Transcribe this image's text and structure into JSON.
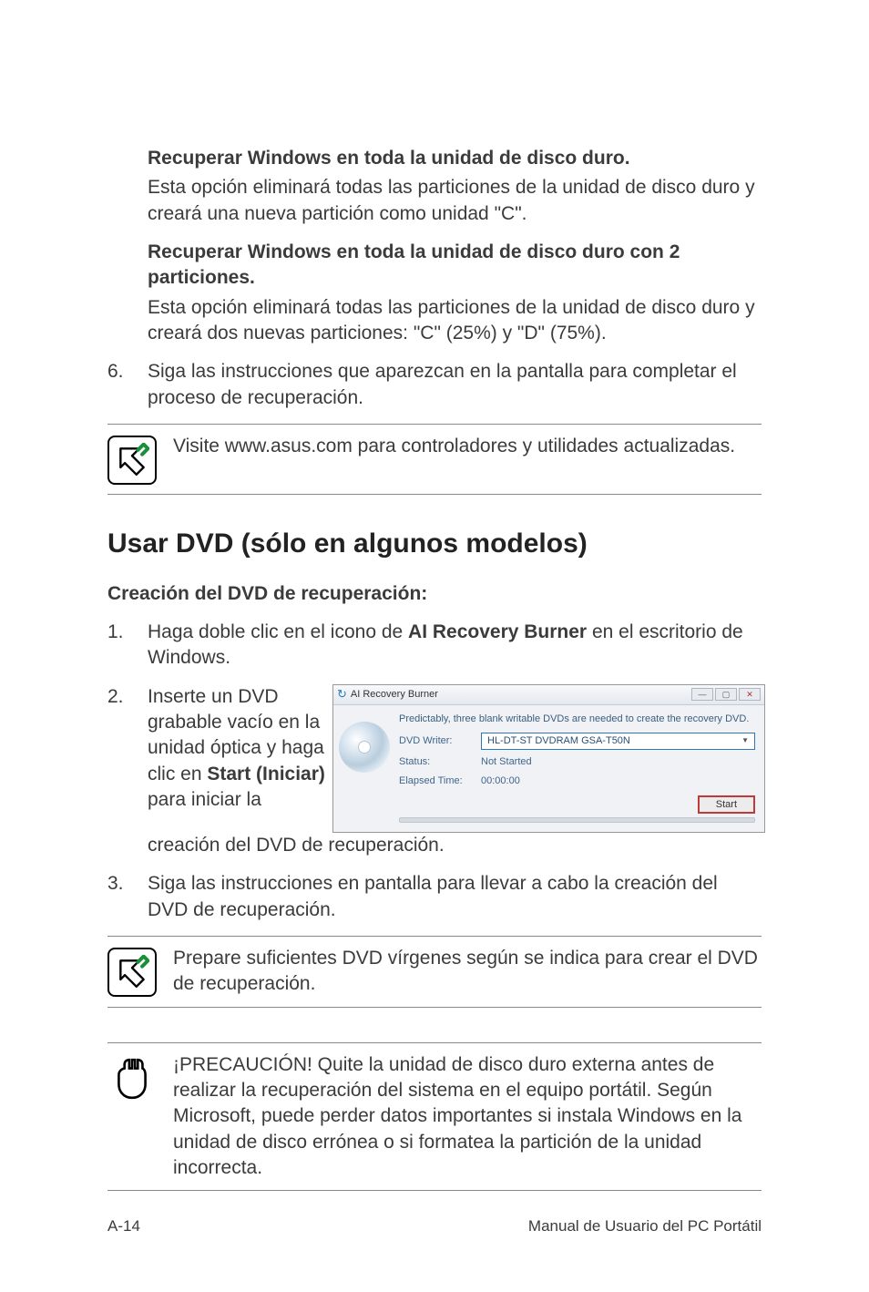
{
  "option_a": {
    "title": "Recuperar Windows en toda la unidad de disco duro.",
    "body": "Esta opción eliminará todas las particiones de la unidad de disco duro y creará una nueva partición como unidad \"C\"."
  },
  "option_b": {
    "title": "Recuperar Windows en toda la unidad de disco duro con 2 particiones.",
    "body": "Esta opción eliminará todas las particiones de la unidad de disco duro y creará dos nuevas particiones: \"C\" (25%) y \"D\" (75%)."
  },
  "step6": {
    "num": "6.",
    "text": "Siga las instrucciones que aparezcan en la pantalla para completar el proceso de recuperación."
  },
  "note1": "Visite www.asus.com para controladores y utilidades actualizadas.",
  "section_title": "Usar DVD (sólo en algunos modelos)",
  "subtitle": "Creación del DVD de recuperación:",
  "step1": {
    "num": "1.",
    "pre": "Haga doble clic en el icono de ",
    "bold": "AI Recovery Burner",
    "post": " en el escritorio de Windows."
  },
  "step2": {
    "num": "2.",
    "pre_left": "Inserte un DVD grabable vacío en la unidad óptica y haga clic en ",
    "bold": "Start (Iniciar)",
    "post_left": " para iniciar la",
    "cont": "creación del DVD de recuperación."
  },
  "screenshot": {
    "window_title": "AI Recovery Burner",
    "predict": "Predictably, three blank writable DVDs are needed to create the recovery DVD.",
    "label_writer": "DVD Writer:",
    "writer_value": "HL-DT-ST DVDRAM GSA-T50N",
    "label_status": "Status:",
    "status_value": "Not Started",
    "label_elapsed": "Elapsed Time:",
    "elapsed_value": "00:00:00",
    "start_btn": "Start"
  },
  "step3": {
    "num": "3.",
    "text": "Siga las instrucciones en pantalla para llevar a cabo la creación del DVD de recuperación."
  },
  "note2": "Prepare suficientes DVD vírgenes según se indica para crear el DVD de recuperación.",
  "caution": "¡PRECAUCIÓN! Quite la unidad de disco duro externa antes de realizar la recuperación del sistema en el equipo portátil. Según Microsoft, puede perder datos importantes si instala Windows en la unidad de disco errónea o si formatea la partición de la unidad incorrecta.",
  "footer": {
    "page": "A-14",
    "label": "Manual de Usuario del PC Portátil"
  }
}
